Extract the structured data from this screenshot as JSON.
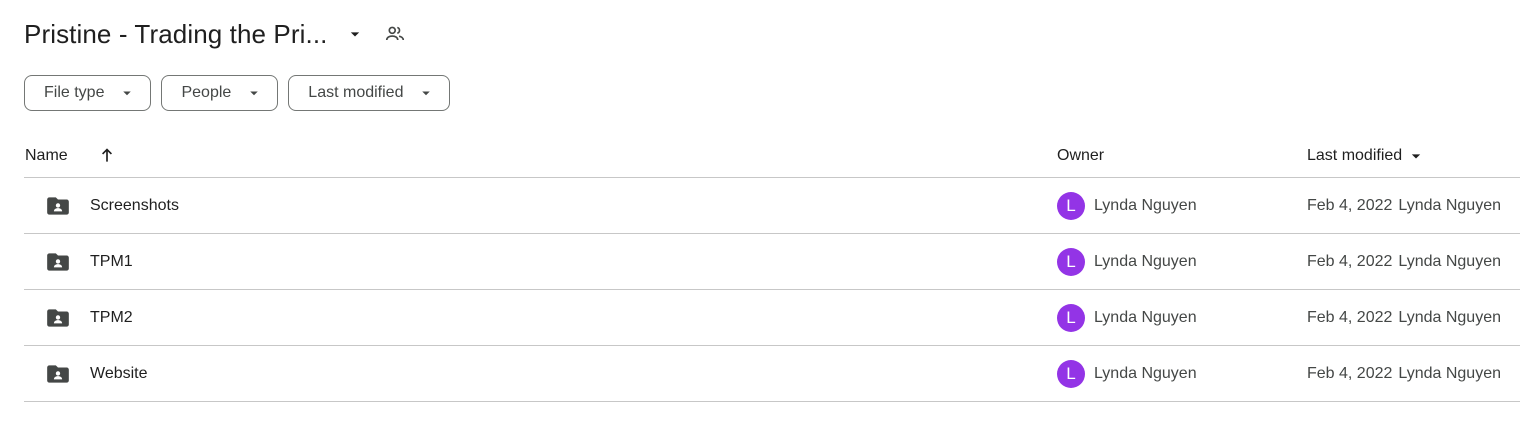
{
  "header": {
    "title": "Pristine - Trading the Pri...",
    "title_dropdown_icon": "arrow-drop-down-icon",
    "share_icon": "people-icon"
  },
  "filters": [
    {
      "label": "File type"
    },
    {
      "label": "People"
    },
    {
      "label": "Last modified"
    }
  ],
  "table": {
    "columns": {
      "name": "Name",
      "owner": "Owner",
      "last_modified": "Last modified"
    },
    "sort_icon": "arrow-upward-icon",
    "rows": [
      {
        "name": "Screenshots",
        "owner_initial": "L",
        "owner": "Lynda Nguyen",
        "modified_date": "Feb 4, 2022",
        "modified_by": "Lynda Nguyen"
      },
      {
        "name": "TPM1",
        "owner_initial": "L",
        "owner": "Lynda Nguyen",
        "modified_date": "Feb 4, 2022",
        "modified_by": "Lynda Nguyen"
      },
      {
        "name": "TPM2",
        "owner_initial": "L",
        "owner": "Lynda Nguyen",
        "modified_date": "Feb 4, 2022",
        "modified_by": "Lynda Nguyen"
      },
      {
        "name": "Website",
        "owner_initial": "L",
        "owner": "Lynda Nguyen",
        "modified_date": "Feb 4, 2022",
        "modified_by": "Lynda Nguyen"
      }
    ]
  },
  "colors": {
    "avatar": "#9334e6",
    "border": "#c7c7c7",
    "icon": "#444746"
  }
}
